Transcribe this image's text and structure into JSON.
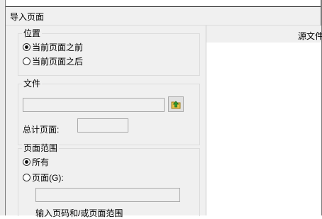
{
  "dialog": {
    "title": "导入页面"
  },
  "position_group": {
    "legend": "位置",
    "options": [
      {
        "label": "当前页面之前",
        "checked": true
      },
      {
        "label": "当前页面之后",
        "checked": false
      }
    ]
  },
  "file_group": {
    "legend": "文件",
    "file_path": "",
    "browse_icon": "folder-up-icon",
    "total_pages_label": "总计页面:",
    "total_pages_value": ""
  },
  "range_group": {
    "legend": "页面范围",
    "options": [
      {
        "label": "所有",
        "checked": true
      },
      {
        "label": "页面(G):",
        "checked": false
      }
    ],
    "pages_value": "",
    "hint": "输入页码和/或页面范围"
  },
  "preview": {
    "label": "源文件"
  }
}
